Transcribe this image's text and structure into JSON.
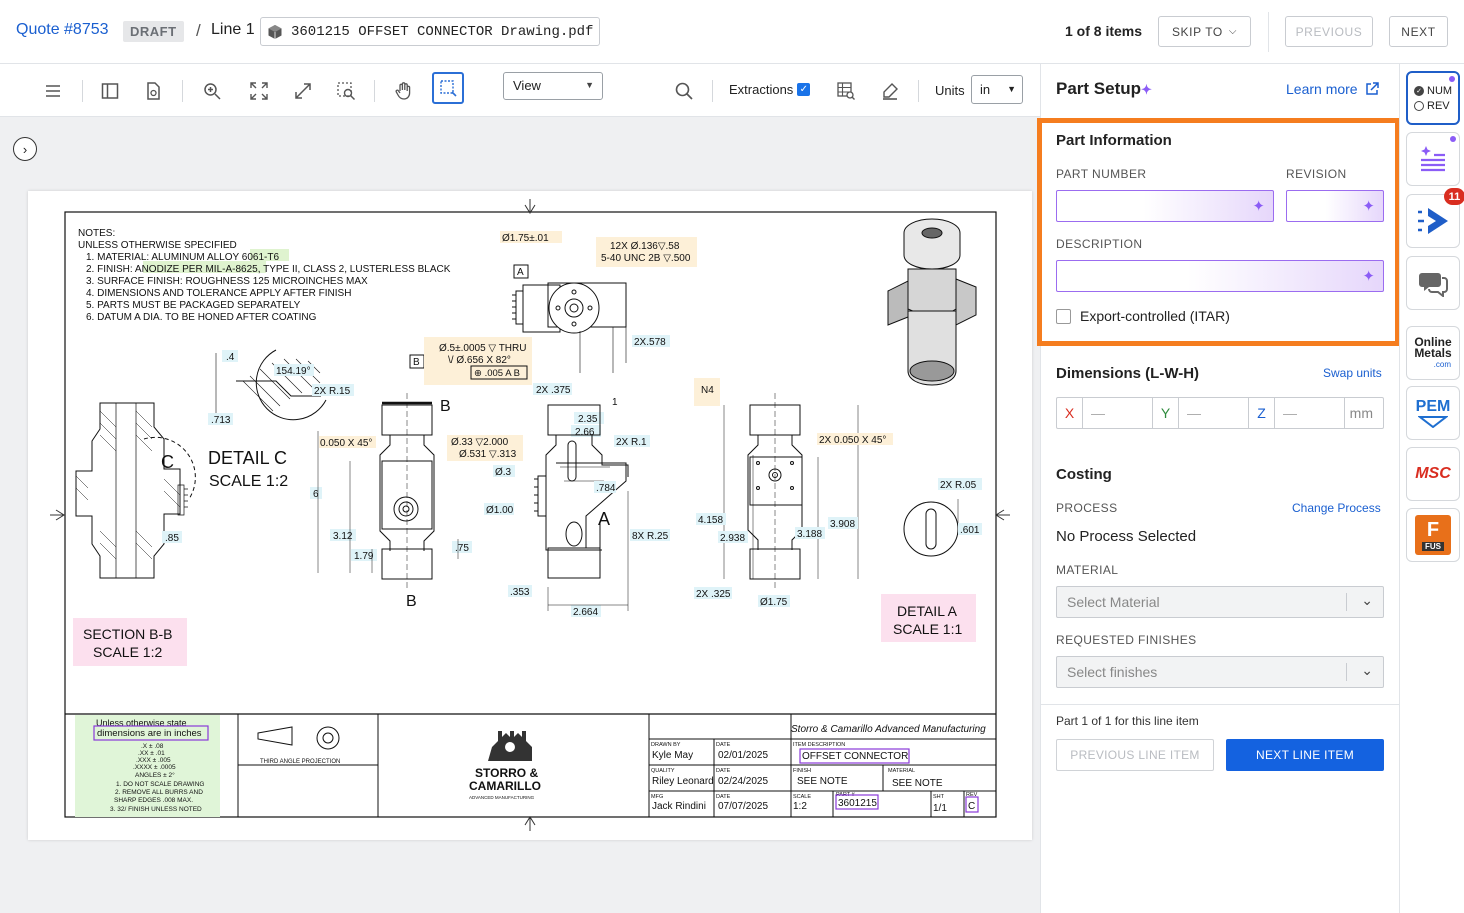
{
  "header": {
    "quote_label": "Quote #8753",
    "status_badge": "DRAFT",
    "separator": "/",
    "line_label": "Line 1",
    "file_name": "3601215 OFFSET CONNECTOR Drawing.pdf",
    "items_count": "1 of 8 items",
    "skip_to_label": "SKIP TO",
    "previous_label": "PREVIOUS",
    "next_label": "NEXT"
  },
  "toolbar": {
    "view_select_value": "View",
    "extractions_label": "Extractions",
    "extractions_checked": true,
    "units_label": "Units",
    "units_value": "in",
    "icons": [
      "menu-icon",
      "sidebar-icon",
      "document-settings-icon",
      "zoom-in-icon",
      "fit-icon",
      "expand-icon",
      "area-zoom-icon",
      "hand-icon",
      "select-region-icon",
      "search-icon",
      "table-search-icon",
      "highlighter-icon"
    ]
  },
  "drawing": {
    "notes_title": "NOTES:",
    "notes_subtitle": "UNLESS OTHERWISE SPECIFIED",
    "notes": [
      "1.    MATERIAL: ALUMINUM ALLOY 6061-T6",
      "2.    FINISH: ANODIZE PER MIL-A-8625, TYPE II, CLASS 2, LUSTERLESS BLACK",
      "3.    SURFACE FINISH: ROUGHNESS 125 MICROINCHES MAX",
      "4.    DIMENSIONS AND TOLERANCE APPLY AFTER FINISH",
      "5.    PARTS MUST BE PACKAGED SEPARATELY",
      "6.    DATUM A DIA. TO BE HONED AFTER COATING"
    ],
    "dims": {
      "d175": "Ø1.75±.01",
      "thread1": "12X Ø.136▽.58",
      "thread2": "5-40 UNC 2B ▽.500",
      "datum_a": "A",
      "datum_b": "B",
      "hole1": "Ø.5±.0005 ▽ THRU",
      "hole2": "\\/ Ø.656 X 82°",
      "fcf": "⊕ .005 A B",
      "d235": "2.35",
      "d266": "2.66",
      "d2x578": "2X.578",
      "d4": ".4",
      "d15419": "154.19°",
      "d2xr15": "2X R.15",
      "d713": ".713",
      "detail_c": "DETAIL C",
      "scale_c": "SCALE 1:2",
      "sec_c": "C",
      "b_top": "B",
      "b_bot": "B",
      "ch050": "0.050 X 45°",
      "h33a": "Ø.33 ▽2.000",
      "h33b": "Ø.531 ▽.313",
      "d6": "6",
      "d312": "3.12",
      "d179": "1.79",
      "d75": ".75",
      "d85": ".85",
      "d2x375": "2X .375",
      "d1": "1",
      "d2xr1": "2X R.1",
      "d03": "Ø.3",
      "d784": ".784",
      "d100": "Ø1.00",
      "sec_a": "A",
      "d8xr25": "8X R.25",
      "d353": ".353",
      "d2664": "2.664",
      "n4": "N4",
      "ch2x050": "2X 0.050 X 45°",
      "d4158": "4.158",
      "d2938": "2.938",
      "d3188": "3.188",
      "d3908": "3.908",
      "d2x325": "2X .325",
      "d175b": "Ø1.75",
      "d2xr05": "2X R.05",
      "d601": ".601",
      "section_bb": "SECTION B-B",
      "scale_bb": "SCALE 1:2",
      "detail_a": "DETAIL A",
      "scale_a": "SCALE 1:1"
    },
    "title_block": {
      "tol_lines": [
        "Unless otherwise state",
        "dimensions are in inches",
        ".X ± .08",
        ".XX ± .01",
        ".XXX ± .005",
        ".XXXX ± .0005",
        "ANGLES ± 2°",
        "1. DO NOT SCALE DRAWING",
        "2. REMOVE ALL BURRS AND",
        "SHARP EDGES .008 MAX.",
        "3. 32/ FINISH UNLESS NOTED"
      ],
      "projection": "THIRD ANGLE PROJECTION",
      "company_line1": "STORRO &",
      "company_line2": "CAMARILLO",
      "company_line3": "ADVANCED MANUFACTURING",
      "company_full": "Storro & Camarillo Advanced Manufacturing",
      "drawn_by_label": "DRAWN BY",
      "drawn_by": "Kyle May",
      "date_label": "DATE",
      "date1": "02/01/2025",
      "item_desc_label": "ITEM DESCRIPTION",
      "item_desc": "OFFSET CONNECTOR",
      "quality_label": "QUALITY",
      "quality": "Riley Leonard",
      "date2": "02/24/2025",
      "finish_label": "FINISH",
      "finish": "SEE NOTE",
      "material_label": "MATERIAL",
      "material": "SEE NOTE",
      "mfg_label": "MFG",
      "mfg": "Jack Rindini",
      "date3": "07/07/2025",
      "scale_label": "SCALE",
      "scale": "1:2",
      "part_label": "PART #",
      "part": "3601215",
      "sht_label": "SHT",
      "sht": "1/1",
      "rev_label": "REV",
      "rev": "C"
    }
  },
  "panel": {
    "title": "Part Setup",
    "learn_more": "Learn more",
    "part_info_title": "Part Information",
    "part_number_label": "PART NUMBER",
    "revision_label": "REVISION",
    "description_label": "DESCRIPTION",
    "itar_label": "Export-controlled (ITAR)",
    "dimensions_title": "Dimensions (L-W-H)",
    "swap_units": "Swap units",
    "dim_x": "X",
    "dim_y": "Y",
    "dim_z": "Z",
    "dim_placeholder": "—",
    "dim_unit": "mm",
    "costing_title": "Costing",
    "process_label": "PROCESS",
    "change_process": "Change Process",
    "process_value": "No Process Selected",
    "material_label": "MATERIAL",
    "material_placeholder": "Select Material",
    "finishes_label": "REQUESTED FINISHES",
    "finishes_placeholder": "Select finishes",
    "part_of": "Part 1 of 1 for this line item",
    "prev_line_item": "PREVIOUS LINE ITEM",
    "next_line_item": "NEXT LINE ITEM"
  },
  "rail": {
    "num_label": "NUM",
    "rev_label": "REV",
    "notifications_count": "11",
    "online_metals_1": "Online",
    "online_metals_2": "Metals",
    "online_metals_3": ".com",
    "pem_label": "PEM",
    "msc_label": "MSC",
    "fus_letter": "F",
    "fus_label": "FUS"
  },
  "colors": {
    "link": "#1a5fd0",
    "highlight": "#f57d1f",
    "primary_button": "#1462e0",
    "ai_purple": "#8b5cf6"
  }
}
